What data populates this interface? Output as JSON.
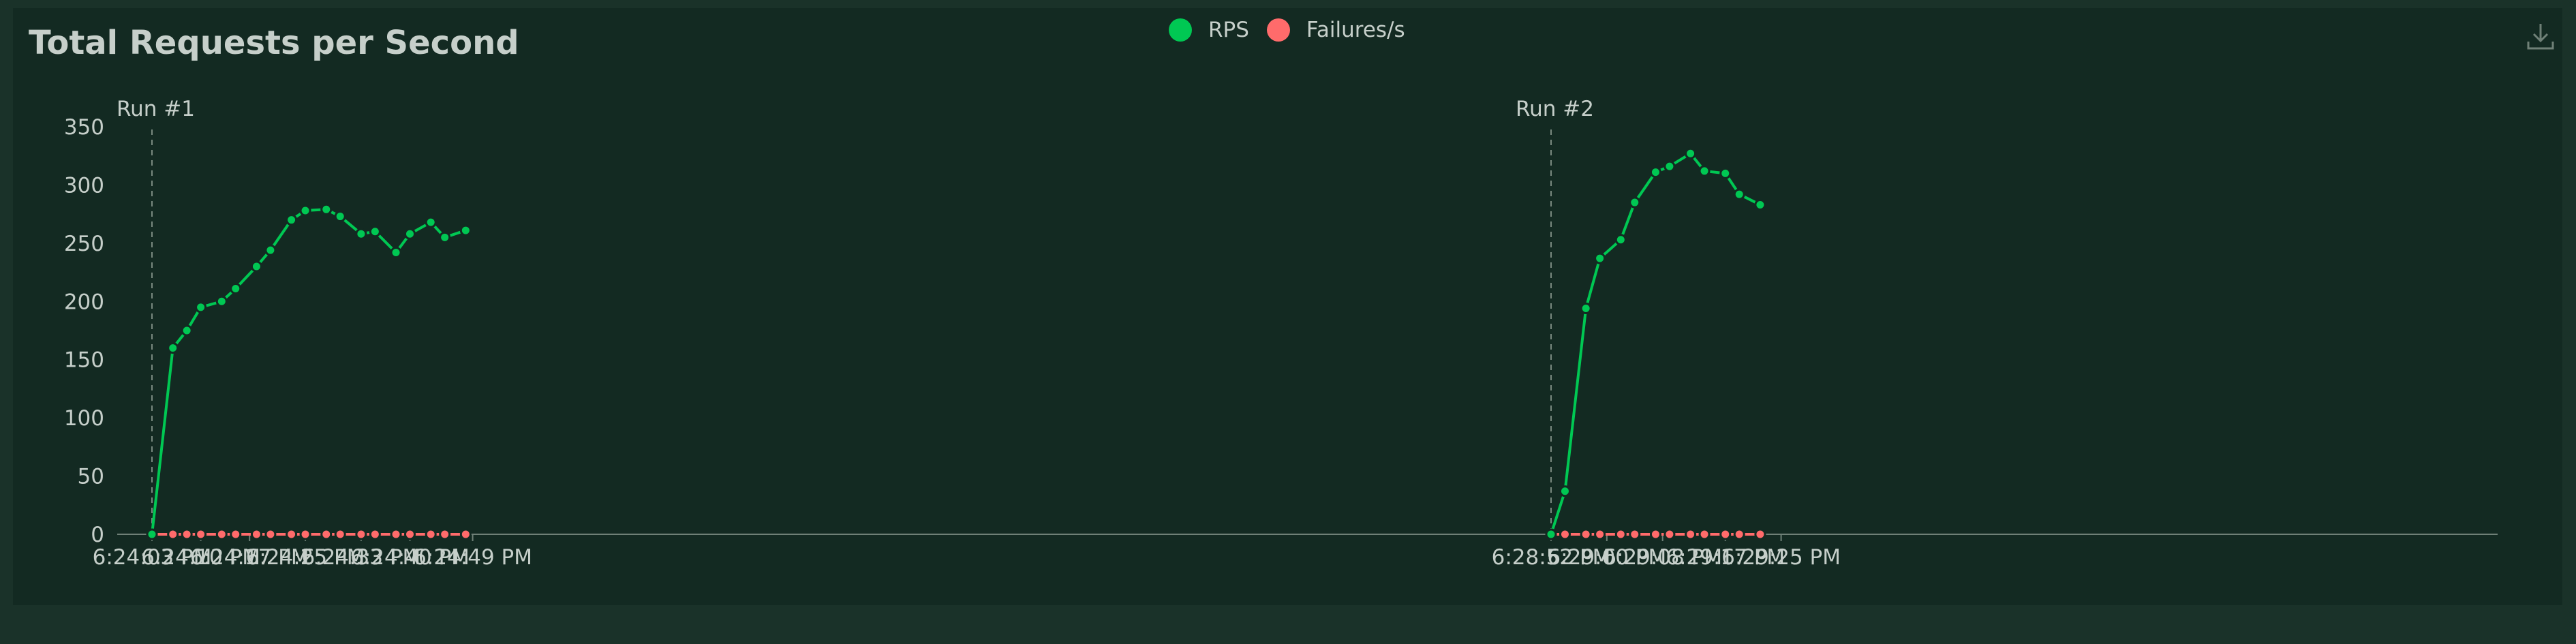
{
  "chart_data": {
    "type": "line",
    "title": "Total Requests per Second",
    "legend_position": "top-center",
    "ylim": [
      0,
      350
    ],
    "yticks": [
      0,
      50,
      100,
      150,
      200,
      250,
      300,
      350
    ],
    "grid": false,
    "x_tick_labels": [
      "6:24:03 PM",
      "6:24:10 PM",
      "6:24:17 PM",
      "6:24:25 PM",
      "6:24:33 PM",
      "6:24:40 PM",
      "6:24:49 PM",
      "6:28:52 PM",
      "6:29:00 PM",
      "6:29:08 PM",
      "6:29:17 PM",
      "6:29:25 PM"
    ],
    "runs": [
      {
        "label": "Run #1",
        "x": [
          "6:24:03 PM",
          "6:24:06 PM",
          "6:24:08 PM",
          "6:24:10 PM",
          "6:24:13 PM",
          "6:24:15 PM",
          "6:24:18 PM",
          "6:24:20 PM",
          "6:24:23 PM",
          "6:24:25 PM",
          "6:24:28 PM",
          "6:24:30 PM",
          "6:24:33 PM",
          "6:24:35 PM",
          "6:24:38 PM",
          "6:24:40 PM",
          "6:24:43 PM",
          "6:24:45 PM",
          "6:24:48 PM"
        ],
        "series": [
          {
            "name": "RPS",
            "color": "#00c853",
            "values": [
              0,
              160,
              175,
              195,
              200,
              211,
              230,
              244,
              270,
              278,
              279,
              273,
              258,
              260,
              242,
              258,
              268,
              255,
              261
            ]
          },
          {
            "name": "Failures/s",
            "color": "#ff6b6b",
            "values": [
              0,
              0,
              0,
              0,
              0,
              0,
              0,
              0,
              0,
              0,
              0,
              0,
              0,
              0,
              0,
              0,
              0,
              0,
              0
            ]
          }
        ]
      },
      {
        "label": "Run #2",
        "x": [
          "6:28:52 PM",
          "6:28:54 PM",
          "6:28:57 PM",
          "6:28:59 PM",
          "6:29:02 PM",
          "6:29:04 PM",
          "6:29:07 PM",
          "6:29:09 PM",
          "6:29:12 PM",
          "6:29:14 PM",
          "6:29:17 PM",
          "6:29:19 PM",
          "6:29:22 PM"
        ],
        "series": [
          {
            "name": "RPS",
            "color": "#00c853",
            "values": [
              0,
              37,
              194,
              237,
              253,
              285,
              311,
              316,
              327,
              312,
              310,
              292,
              283
            ]
          },
          {
            "name": "Failures/s",
            "color": "#ff6b6b",
            "values": [
              0,
              0,
              0,
              0,
              0,
              0,
              0,
              0,
              0,
              0,
              0,
              0,
              0
            ]
          }
        ]
      }
    ]
  },
  "legend": [
    {
      "name": "RPS",
      "color": "#00c853"
    },
    {
      "name": "Failures/s",
      "color": "#ff6b6b"
    }
  ],
  "icons": {
    "download": "download-icon"
  }
}
